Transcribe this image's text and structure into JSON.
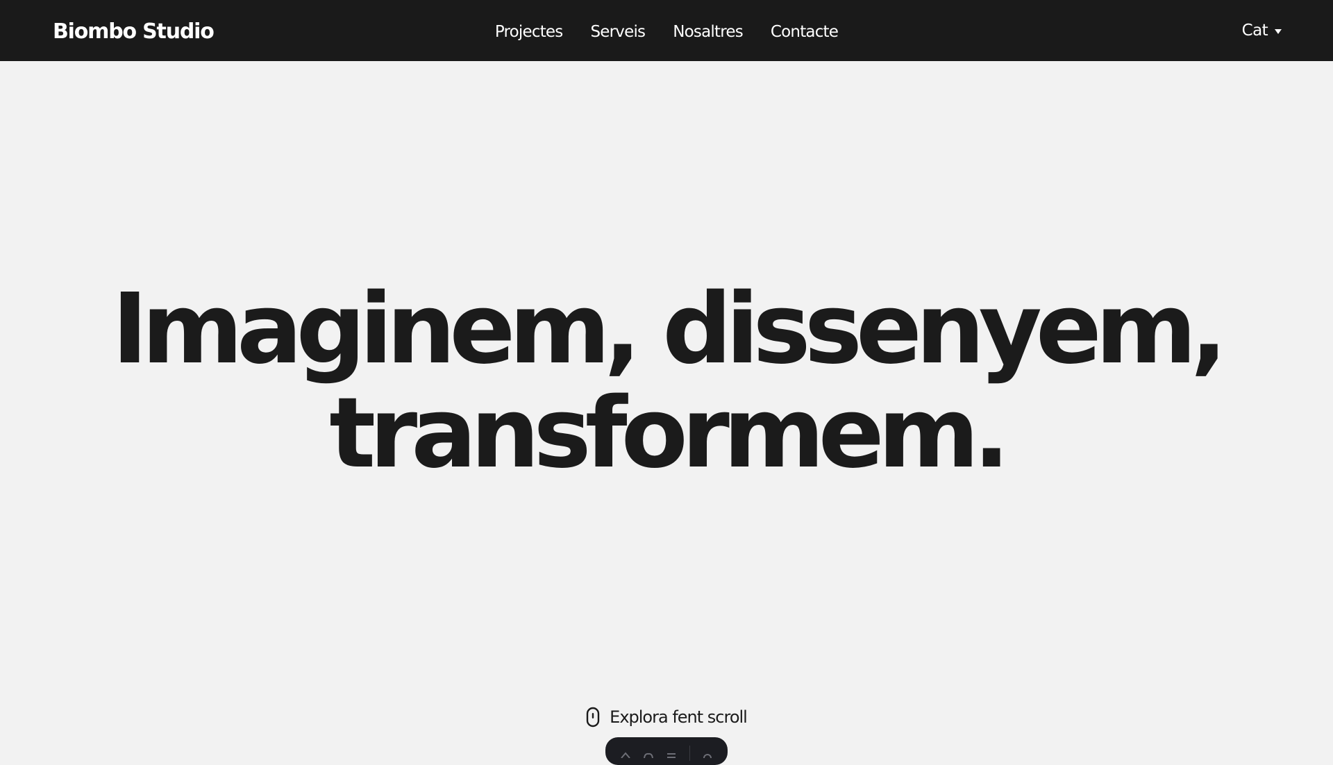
{
  "header": {
    "brand": "Biombo Studio",
    "nav": [
      {
        "label": "Projectes"
      },
      {
        "label": "Serveis"
      },
      {
        "label": "Nosaltres"
      },
      {
        "label": "Contacte"
      }
    ],
    "language": {
      "selected": "Cat",
      "icon": "chevron-down-icon"
    }
  },
  "hero": {
    "line1": "Imaginem, dissenyem,",
    "line2": "transformem."
  },
  "scroll_hint": {
    "icon": "mouse-icon",
    "text": "Explora fent scroll"
  },
  "dock": {
    "icons": [
      "home-icon",
      "cloud-icon",
      "menu-icon",
      "settings-icon"
    ]
  },
  "colors": {
    "header_bg": "#1a1a1a",
    "page_bg": "#f2f2f2",
    "text": "#1b1b1b",
    "dock_bg": "#1c1d22"
  }
}
